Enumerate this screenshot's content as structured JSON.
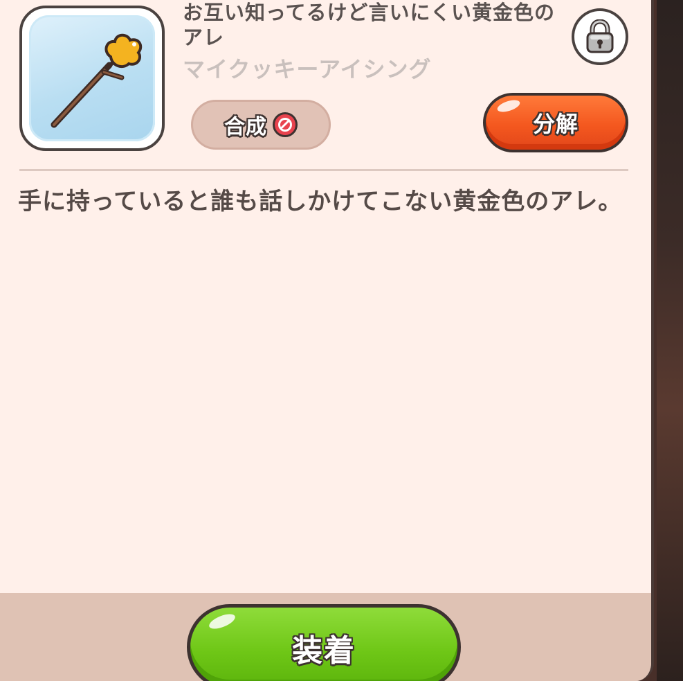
{
  "item": {
    "name": "お互い知ってるけど言いにくい黄金色のアレ",
    "subname": "マイクッキーアイシング",
    "icon": "golden-stick-icon",
    "description": "手に持っていると誰も話しかけてこない黄金色のアレ。"
  },
  "actions": {
    "compose_label": "合成",
    "compose_status_icon": "prohibited-icon",
    "decompose_label": "分解",
    "lock_icon": "padlock-icon",
    "equip_label": "装着"
  },
  "colors": {
    "panel_bg": "#fff0ea",
    "footer_bg": "#dfc2b4",
    "decompose_button": "#f4581f",
    "equip_button": "#6fc717",
    "compose_button_disabled": "#e1c2b6",
    "prohibited_red": "#e8434e"
  }
}
